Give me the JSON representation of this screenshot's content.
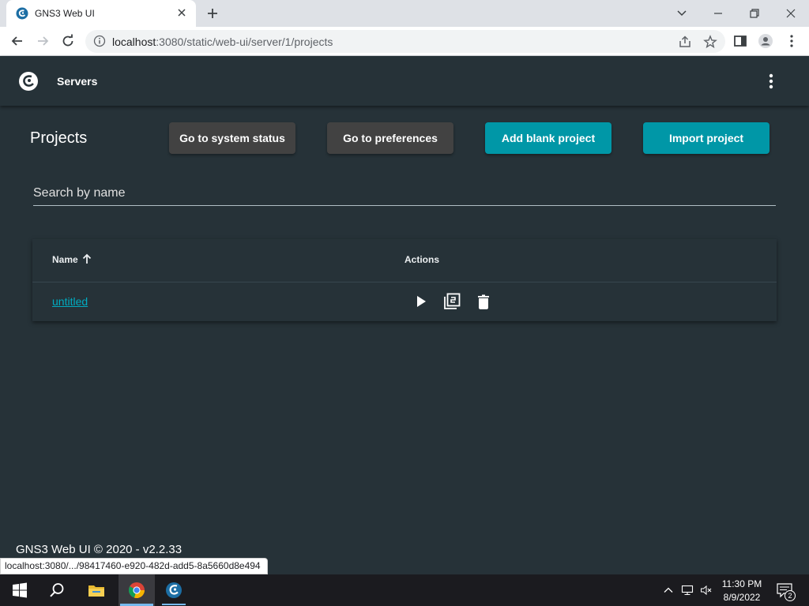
{
  "browser": {
    "tab_title": "GNS3 Web UI",
    "url_host": "localhost",
    "url_rest": ":3080/static/web-ui/server/1/projects"
  },
  "header": {
    "servers_label": "Servers"
  },
  "page": {
    "title": "Projects",
    "buttons": {
      "system_status": "Go to system status",
      "preferences": "Go to preferences",
      "add_blank": "Add blank project",
      "import": "Import project"
    },
    "search_placeholder": "Search by name"
  },
  "table": {
    "col_name": "Name",
    "col_actions": "Actions",
    "sort": "ascending",
    "rows": [
      {
        "name": "untitled"
      }
    ]
  },
  "footer": "GNS3 Web UI © 2020 - v2.2.33",
  "status_url": "localhost:3080/.../98417460-e920-482d-add5-8a5660d8e494",
  "taskbar": {
    "time": "11:30 PM",
    "date": "8/9/2022",
    "notification_count": "2"
  },
  "colors": {
    "app_background": "#263238",
    "accent_teal": "#0097a7",
    "secondary_button": "#424242",
    "link": "#00acc1"
  },
  "icons": [
    "gns3-logo-icon",
    "more-vert-icon",
    "arrow-up-icon",
    "play-icon",
    "duplicate-icon",
    "delete-icon"
  ]
}
